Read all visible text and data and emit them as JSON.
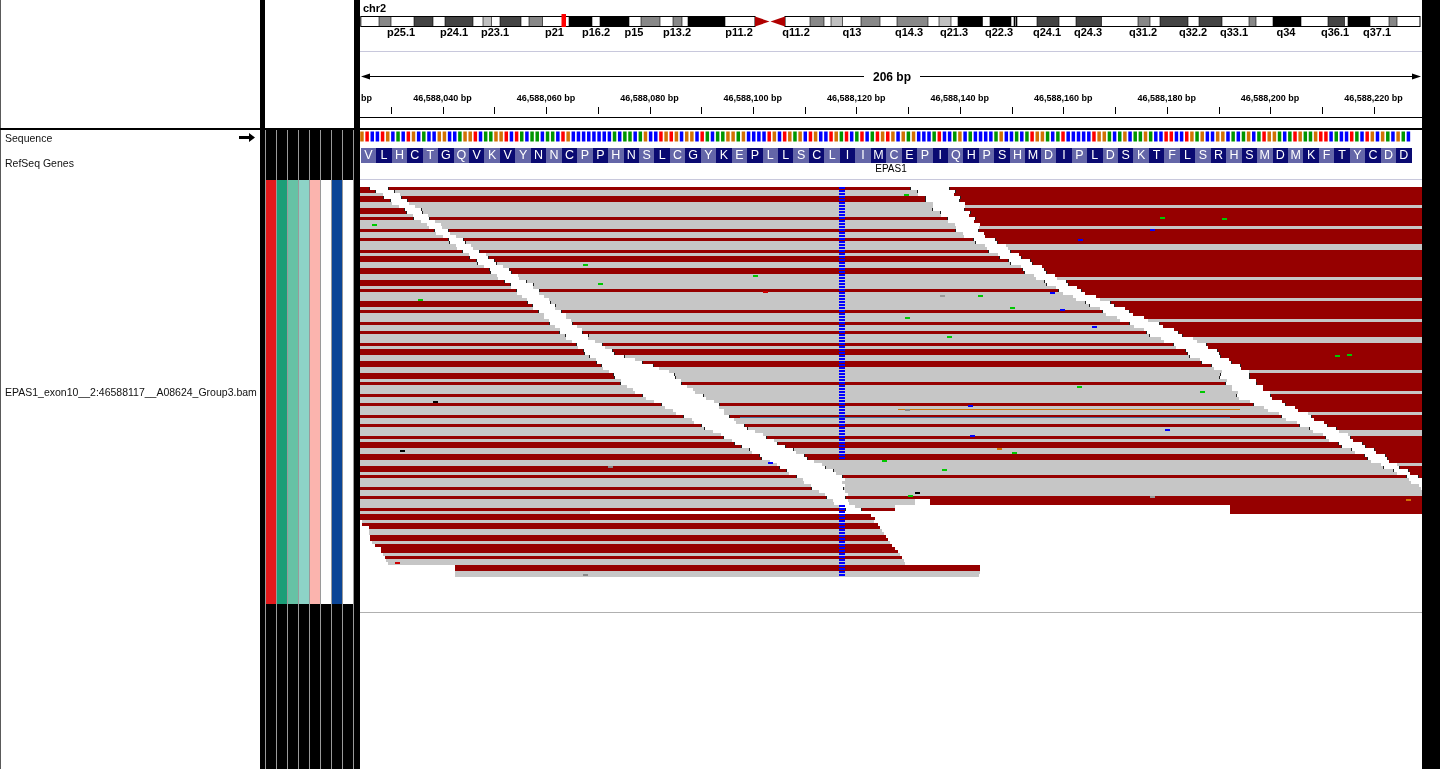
{
  "ideogram": {
    "chromosome": "chr2",
    "cytobands": [
      "p25.1",
      "p24.1",
      "p23.1",
      "p21",
      "p16.2",
      "p15",
      "p13.2",
      "p11.2",
      "q11.2",
      "q13",
      "q14.3",
      "q21.3",
      "q22.3",
      "q24.1",
      "q24.3",
      "q31.2",
      "q32.2",
      "q33.1",
      "q34",
      "q36.1",
      "q37.1"
    ]
  },
  "ruler": {
    "span": "206 bp",
    "ticks": [
      "bp",
      "46,588,040 bp",
      "46,588,060 bp",
      "46,588,080 bp",
      "46,588,100 bp",
      "46,588,120 bp",
      "46,588,140 bp",
      "46,588,160 bp",
      "46,588,180 bp",
      "46,588,200 bp",
      "46,588,220 bp"
    ]
  },
  "tracks": [
    {
      "kind": "sequence",
      "name": "Sequence",
      "forward_strand": true
    },
    {
      "kind": "gene",
      "name": "RefSeq Genes",
      "gene": "EPAS1",
      "amino_acids": [
        "V",
        "L",
        "H",
        "C",
        "T",
        "G",
        "Q",
        "V",
        "K",
        "V",
        "Y",
        "N",
        "N",
        "C",
        "P",
        "P",
        "H",
        "N",
        "S",
        "L",
        "C",
        "G",
        "Y",
        "K",
        "E",
        "P",
        "L",
        "L",
        "S",
        "C",
        "L",
        "I",
        "I",
        "M",
        "C",
        "E",
        "P",
        "I",
        "Q",
        "H",
        "P",
        "S",
        "H",
        "M",
        "D",
        "I",
        "P",
        "L",
        "D",
        "S",
        "K",
        "T",
        "F",
        "L",
        "S",
        "R",
        "H",
        "S",
        "M",
        "D",
        "M",
        "K",
        "F",
        "T",
        "Y",
        "C",
        "D",
        "D"
      ]
    },
    {
      "kind": "alignment",
      "name": "EPAS1_exon10__2:46588117__A08624_Group3.bam",
      "attributes": [
        {
          "color": "#e31a1c"
        },
        {
          "color": "#1b9e77"
        },
        {
          "color": "#66c2a5"
        },
        {
          "color": "#8dd3c7"
        },
        {
          "color": "#fbb4ae"
        },
        {
          "color": "#ffffff"
        },
        {
          "color": "#0b4596"
        },
        {
          "color": "#ffffff"
        }
      ]
    }
  ]
}
